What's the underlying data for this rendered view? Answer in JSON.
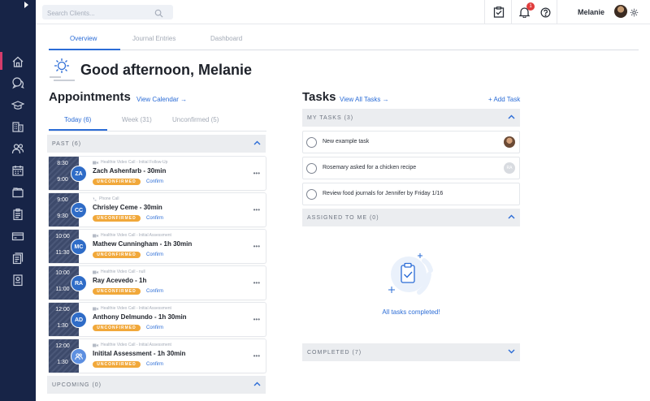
{
  "search": {
    "placeholder": "Search Clients..."
  },
  "header": {
    "user_name": "Melanie",
    "notification_count": "1"
  },
  "page_tabs": [
    {
      "label": "Overview"
    },
    {
      "label": "Journal Entries"
    },
    {
      "label": "Dashboard"
    }
  ],
  "greeting": "Good afternoon, Melanie",
  "appointments": {
    "title": "Appointments",
    "view_link": "View Calendar →",
    "tabs": [
      {
        "label": "Today (6)"
      },
      {
        "label": "Week (31)"
      },
      {
        "label": "Unconfirmed (5)"
      }
    ],
    "past_header": "PAST (6)",
    "upcoming_header": "UPCOMING (0)",
    "status_label": "UNCONFIRMED",
    "confirm_label": "Confirm",
    "more_label": "•••",
    "items": [
      {
        "start": "8:30",
        "end": "9:00",
        "initials": "ZA",
        "type": "Healthie Video Call - Initial Follow-Up",
        "name": "Zach Ashenfarb - 30min",
        "icon": "video-icon"
      },
      {
        "start": "9:00",
        "end": "9:30",
        "initials": "CC",
        "type": "Phone Call",
        "name": "Chrisley Ceme - 30min",
        "icon": "phone-icon"
      },
      {
        "start": "10:00",
        "end": "11:30",
        "initials": "MC",
        "type": "Healthie Video Call - Initial Assessment",
        "name": "Mathew Cunningham - 1h 30min",
        "icon": "video-icon"
      },
      {
        "start": "10:00",
        "end": "11:00",
        "initials": "RA",
        "type": "Healthie Video Call - null",
        "name": "Ray Acevedo - 1h",
        "icon": "video-icon"
      },
      {
        "start": "12:00",
        "end": "1:30",
        "initials": "AD",
        "type": "Healthie Video Call - Initial Assessment",
        "name": "Anthony Delmundo - 1h 30min",
        "icon": "video-icon"
      },
      {
        "start": "12:00",
        "end": "1:30",
        "initials": "",
        "type": "Healthie Video Call - Initial Assessment",
        "name": "Initital Assessment - 1h 30min",
        "icon": "video-icon"
      }
    ]
  },
  "tasks": {
    "title": "Tasks",
    "view_link": "View All Tasks →",
    "add_label": "+ Add Task",
    "my_tasks_header": "MY TASKS (3)",
    "assigned_header": "ASSIGNED TO ME (0)",
    "completed_header": "COMPLETED (7)",
    "empty_text": "All tasks completed!",
    "items": [
      {
        "label": "New example task",
        "avatar": "photo"
      },
      {
        "label": "Rosemary asked for a chicken recipe",
        "avatar": "RA"
      },
      {
        "label": "Review food journals for Jennifer by Friday 1/16",
        "avatar": ""
      }
    ]
  },
  "colors": {
    "sidebar": "#172447",
    "accent": "#2b6cd6",
    "status": "#f1a83a",
    "badge": "#e03c3c"
  }
}
